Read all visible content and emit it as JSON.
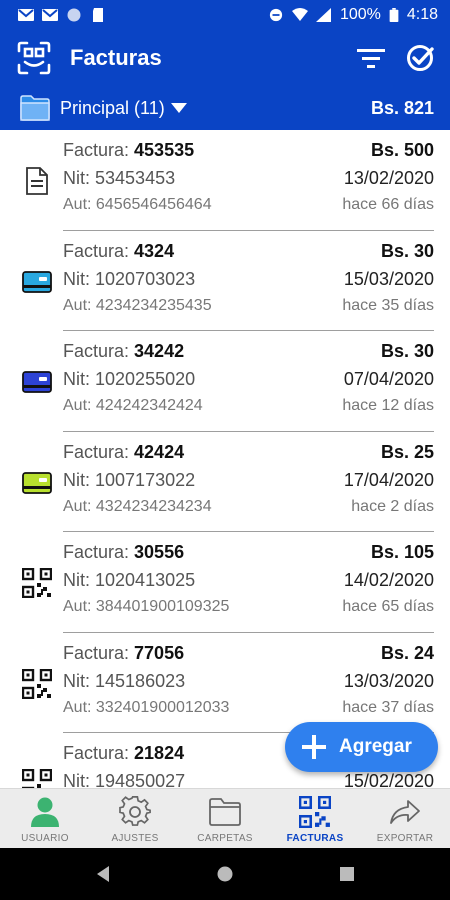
{
  "status": {
    "battery": "100%",
    "time": "4:18"
  },
  "header": {
    "title": "Facturas"
  },
  "folder": {
    "name": "Principal (11)",
    "total": "Bs. 821"
  },
  "labels": {
    "factura": "Factura: ",
    "nit": "Nit: ",
    "aut": "Aut: "
  },
  "invoices": [
    {
      "number": "453535",
      "amount": "Bs. 500",
      "nit": "53453453",
      "date": "13/02/2020",
      "aut": "6456546456464",
      "ago": "hace 66 días",
      "icon": "document-icon"
    },
    {
      "number": "4324",
      "amount": "Bs. 30",
      "nit": "1020703023",
      "date": "15/03/2020",
      "aut": "4234234235435",
      "ago": "hace 35 días",
      "icon": "card-icon",
      "color": "#29a8e0"
    },
    {
      "number": "34242",
      "amount": "Bs. 30",
      "nit": "1020255020",
      "date": "07/04/2020",
      "aut": "424242342424",
      "ago": "hace 12 días",
      "icon": "card-icon",
      "color": "#2d43d6"
    },
    {
      "number": "42424",
      "amount": "Bs. 25",
      "nit": "1007173022",
      "date": "17/04/2020",
      "aut": "4324234234234",
      "ago": "hace 2 días",
      "icon": "card-icon",
      "color": "#b8e02e"
    },
    {
      "number": "30556",
      "amount": "Bs. 105",
      "nit": "1020413025",
      "date": "14/02/2020",
      "aut": "384401900109325",
      "ago": "hace 65 días",
      "icon": "qr-icon"
    },
    {
      "number": "77056",
      "amount": "Bs. 24",
      "nit": "145186023",
      "date": "13/03/2020",
      "aut": "332401900012033",
      "ago": "hace 37 días",
      "icon": "qr-icon"
    },
    {
      "number": "21824",
      "amount": "",
      "nit": "194850027",
      "date": "15/02/2020",
      "aut": "",
      "ago": "",
      "icon": "qr-icon"
    }
  ],
  "fab": {
    "label": "Agregar"
  },
  "nav": [
    {
      "label": "USUARIO"
    },
    {
      "label": "AJUSTES"
    },
    {
      "label": "CARPETAS"
    },
    {
      "label": "FACTURAS"
    },
    {
      "label": "EXPORTAR"
    }
  ],
  "colors": {
    "primary": "#0a44c5",
    "fab": "#2f80ee",
    "user_green": "#3cb371",
    "active_nav": "#0a44c5"
  }
}
